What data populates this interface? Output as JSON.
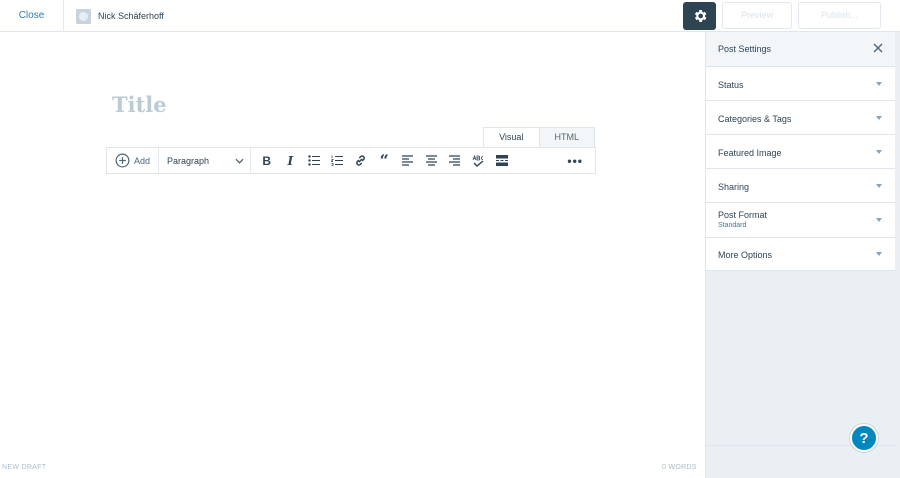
{
  "topbar": {
    "close_label": "Close",
    "site_name": "Nick Schäferhoff",
    "preview_label": "Preview",
    "publish_label": "Publish..."
  },
  "editor": {
    "title_placeholder": "Title",
    "tabs": [
      {
        "label": "Visual",
        "active": true
      },
      {
        "label": "HTML",
        "active": false
      }
    ],
    "toolbar": {
      "add_label": "Add",
      "format_value": "Paragraph",
      "buttons": [
        "bold",
        "italic",
        "bullet-list",
        "numbered-list",
        "link",
        "blockquote",
        "align-left",
        "align-center",
        "align-right",
        "spellcheck",
        "read-more",
        "more"
      ]
    },
    "status_left": "NEW DRAFT",
    "word_count": "0 WORDS"
  },
  "sidebar": {
    "title": "Post Settings",
    "panels": [
      {
        "label": "Status"
      },
      {
        "label": "Categories & Tags"
      },
      {
        "label": "Featured Image"
      },
      {
        "label": "Sharing"
      },
      {
        "label": "Post Format",
        "sublabel": "Standard"
      },
      {
        "label": "More Options"
      }
    ]
  },
  "colors": {
    "accent": "#0087be",
    "dark": "#2e4453",
    "link": "#2e7cb0"
  }
}
